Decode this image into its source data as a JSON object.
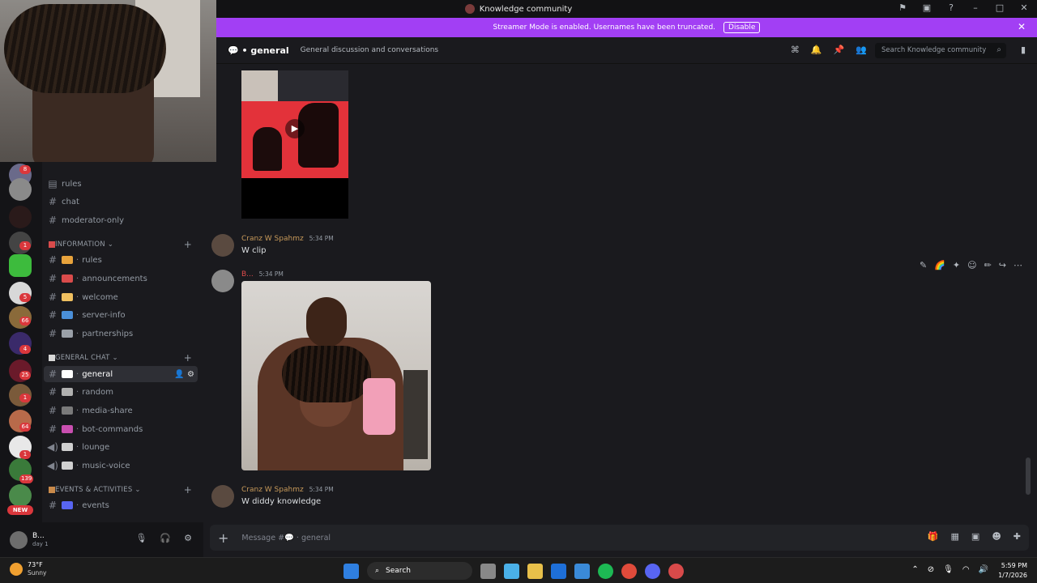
{
  "window": {
    "title": "Knowledge community"
  },
  "banner": {
    "text": "Streamer Mode is enabled. Usernames have been truncated.",
    "disable_label": "Disable",
    "close": "✕"
  },
  "sidebar": {
    "top_channels": [
      {
        "label": "rules"
      },
      {
        "label": "chat"
      },
      {
        "label": "moderator-only"
      }
    ],
    "categories": [
      {
        "label": "INFORMATION",
        "channels": [
          {
            "label": "rules",
            "color": "#e8a33c"
          },
          {
            "label": "announcements",
            "color": "#d94b4b"
          },
          {
            "label": "welcome",
            "color": "#f0c060"
          },
          {
            "label": "server-info",
            "color": "#4a8fd8"
          },
          {
            "label": "partnerships",
            "color": "#9aa0a8"
          }
        ]
      },
      {
        "label": "GENERAL CHAT",
        "channels": [
          {
            "label": "general",
            "color": "#ffffff"
          },
          {
            "label": "random",
            "color": "#b0b0b0"
          },
          {
            "label": "media-share",
            "color": "#7a7a7a"
          },
          {
            "label": "bot-commands",
            "color": "#c94fb0"
          },
          {
            "label": "lounge",
            "color": "#d0d0d0"
          },
          {
            "label": "music-voice",
            "color": "#d0d0d0"
          }
        ]
      },
      {
        "label": "EVENTS & ACTIVITIES",
        "channels": [
          {
            "label": "events",
            "color": "#5865f2"
          }
        ]
      }
    ],
    "server_badges": [
      "8",
      "1",
      "5",
      "66",
      "4",
      "25",
      "1",
      "64",
      "1",
      "139"
    ],
    "new_badge": "NEW"
  },
  "user": {
    "name": "B...",
    "status": "day 1"
  },
  "header": {
    "channel": "general",
    "topic": "General discussion and conversations",
    "search_placeholder": "Search Knowledge community"
  },
  "messages": [
    {
      "author": "Cranz W Spahmz",
      "time": "5:34 PM",
      "text": "W clip"
    },
    {
      "author": "B...",
      "time": "5:34 PM",
      "text": ""
    },
    {
      "author": "Cranz W Spahmz",
      "time": "5:34 PM",
      "text": "W diddy knowledge"
    }
  ],
  "composer": {
    "placeholder": "Message #",
    "channel": "general"
  },
  "taskbar": {
    "weather_temp": "73°F",
    "weather_desc": "Sunny",
    "search_label": "Search",
    "time": "5:59 PM",
    "date": "1/7/2026"
  },
  "colors": {
    "banner": "#a23ff4",
    "author": "#c89a5a",
    "background": "#1a1a1e"
  }
}
